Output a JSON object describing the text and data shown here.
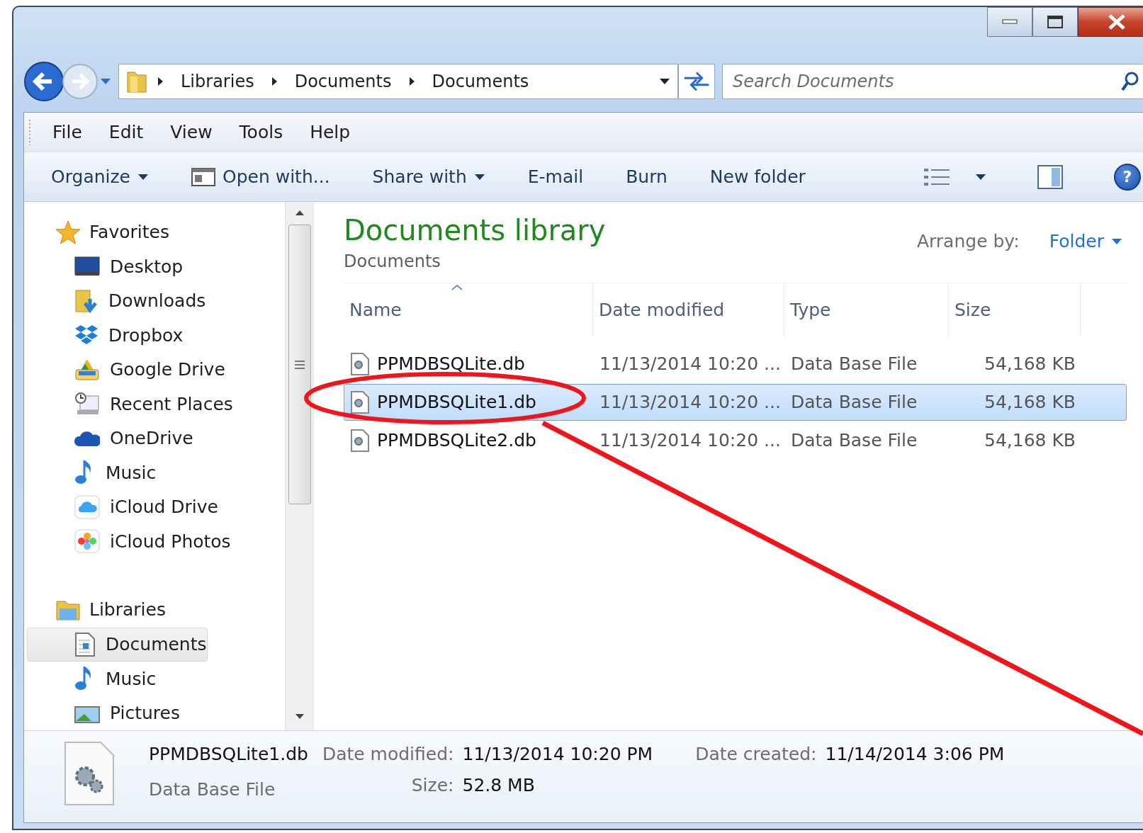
{
  "address": {
    "crumbs": [
      "Libraries",
      "Documents",
      "Documents"
    ]
  },
  "search": {
    "placeholder": "Search Documents"
  },
  "menu": [
    "File",
    "Edit",
    "View",
    "Tools",
    "Help"
  ],
  "toolbar": [
    {
      "label": "Organize",
      "kind": "dropdown"
    },
    {
      "label": "Open with...",
      "kind": "icon"
    },
    {
      "label": "Share with",
      "kind": "dropdown"
    },
    {
      "label": "E-mail",
      "kind": "plain"
    },
    {
      "label": "Burn",
      "kind": "plain"
    },
    {
      "label": "New folder",
      "kind": "plain"
    }
  ],
  "help_button": "?",
  "sidebar": {
    "groups": [
      {
        "label": "Favorites",
        "children": [
          {
            "label": "Desktop",
            "selected": false
          },
          {
            "label": "Downloads",
            "selected": false
          },
          {
            "label": "Dropbox",
            "selected": false
          },
          {
            "label": "Google Drive",
            "selected": false
          },
          {
            "label": "Recent Places",
            "selected": false
          },
          {
            "label": "OneDrive",
            "selected": false
          },
          {
            "label": "Music",
            "selected": false
          },
          {
            "label": "iCloud Drive",
            "selected": false
          },
          {
            "label": "iCloud Photos",
            "selected": false
          }
        ]
      },
      {
        "label": "Libraries",
        "children": [
          {
            "label": "Documents",
            "selected": true
          },
          {
            "label": "Music",
            "selected": false
          },
          {
            "label": "Pictures",
            "selected": false
          }
        ]
      }
    ]
  },
  "library": {
    "title": "Documents library",
    "subtitle": "Documents",
    "arrange_label": "Arrange by:",
    "arrange_value": "Folder"
  },
  "table": {
    "columns": [
      {
        "label": "Name",
        "sorted": true
      },
      {
        "label": "Date modified",
        "sorted": false
      },
      {
        "label": "Type",
        "sorted": false
      },
      {
        "label": "Size",
        "sorted": false
      }
    ],
    "rows": [
      {
        "cells": [
          "PPMDBSQLite.db",
          "11/13/2014 10:20 ...",
          "Data Base File",
          "54,168 KB"
        ],
        "selected": false
      },
      {
        "cells": [
          "PPMDBSQLite1.db",
          "11/13/2014 10:20 ...",
          "Data Base File",
          "54,168 KB"
        ],
        "selected": true
      },
      {
        "cells": [
          "PPMDBSQLite2.db",
          "11/13/2014 10:20 ...",
          "Data Base File",
          "54,168 KB"
        ],
        "selected": false
      }
    ]
  },
  "details": {
    "name": "PPMDBSQLite1.db",
    "type": "Data Base File",
    "fields": [
      {
        "label": "Date modified:",
        "value": "11/13/2014 10:20 PM"
      },
      {
        "label": "Size:",
        "value": "52.8 MB"
      },
      {
        "label": "Date created:",
        "value": "11/14/2014 3:06 PM"
      }
    ]
  }
}
